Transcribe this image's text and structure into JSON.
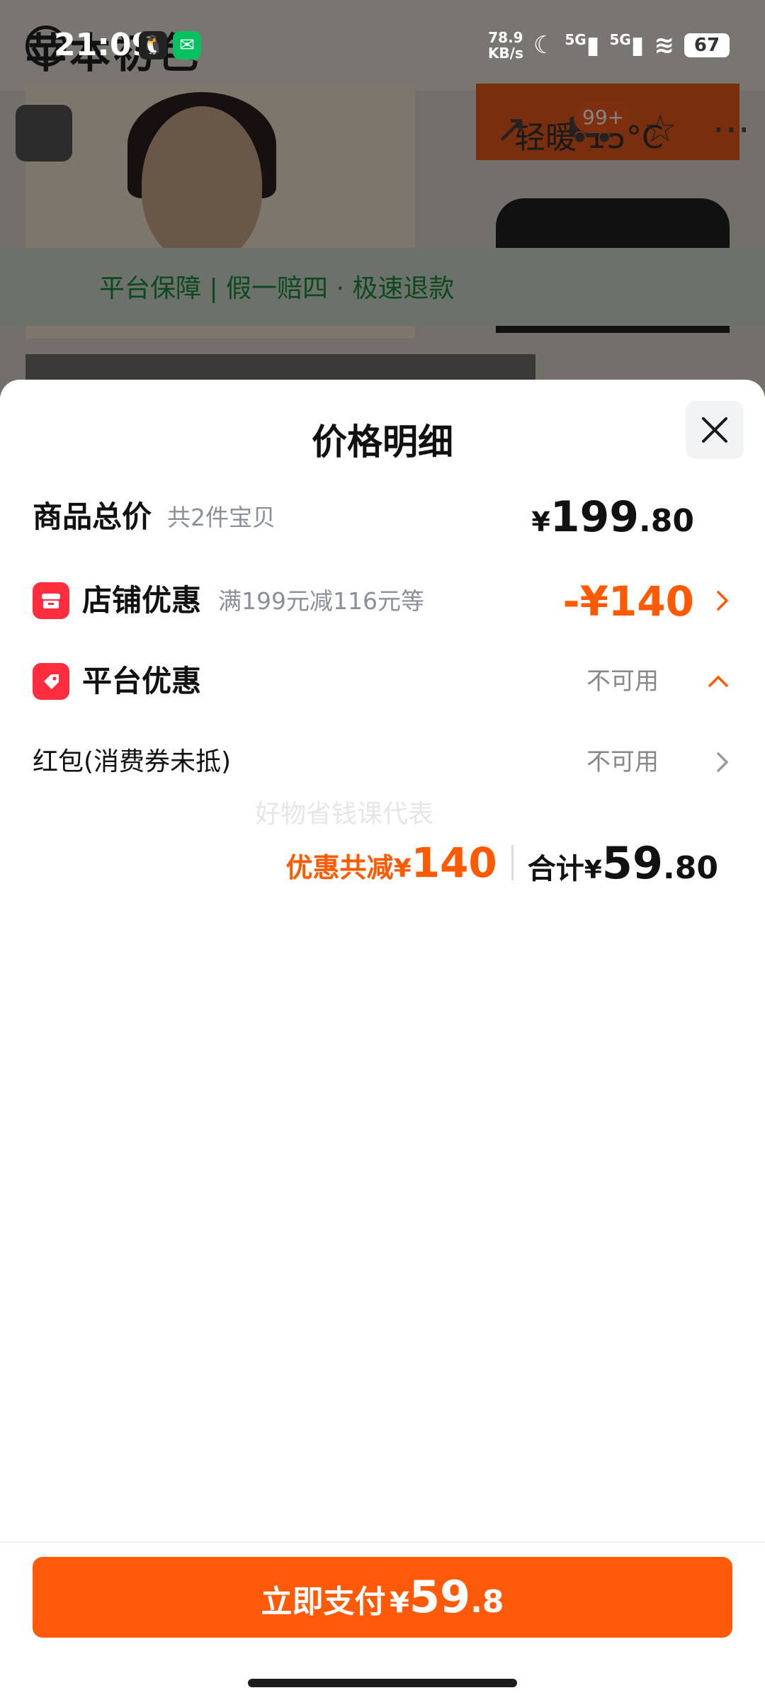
{
  "status_bar": {
    "time": "21:09",
    "net_speed_value": "78.9",
    "net_speed_unit": "KB/s",
    "signal_1": "5G",
    "signal_2": "5G",
    "battery": "67"
  },
  "background": {
    "shop_title": "苹本初色",
    "cart_badge": "99+",
    "weather": "轻暖 15°C",
    "guarantee": "平台保障 | 假一赔四 · 极速退款"
  },
  "sheet": {
    "title": "价格明细",
    "goods_total": {
      "label": "商品总价",
      "sub": "共2件宝贝",
      "currency": "¥",
      "integer": "199",
      "decimal": ".80"
    },
    "shop_discount": {
      "label": "店铺优惠",
      "sub": "满199元减116元等",
      "amount": "-¥140"
    },
    "platform_discount": {
      "label": "平台优惠",
      "status": "不可用"
    },
    "red_packet": {
      "label": "红包(消费券未抵)",
      "status": "不可用"
    },
    "watermark": "好物省钱课代表",
    "summary": {
      "discount_label": "优惠共减",
      "discount_currency": "¥",
      "discount_value": "140",
      "total_label": "合计",
      "total_currency": "¥",
      "total_integer": "59",
      "total_decimal": ".80"
    }
  },
  "footer": {
    "pay_label": "立即支付",
    "pay_currency": "¥",
    "pay_integer": "59",
    "pay_decimal": ".8"
  },
  "colors": {
    "accent": "#ff5a00",
    "badge_red": "#ff2d3e",
    "muted": "#888888"
  }
}
